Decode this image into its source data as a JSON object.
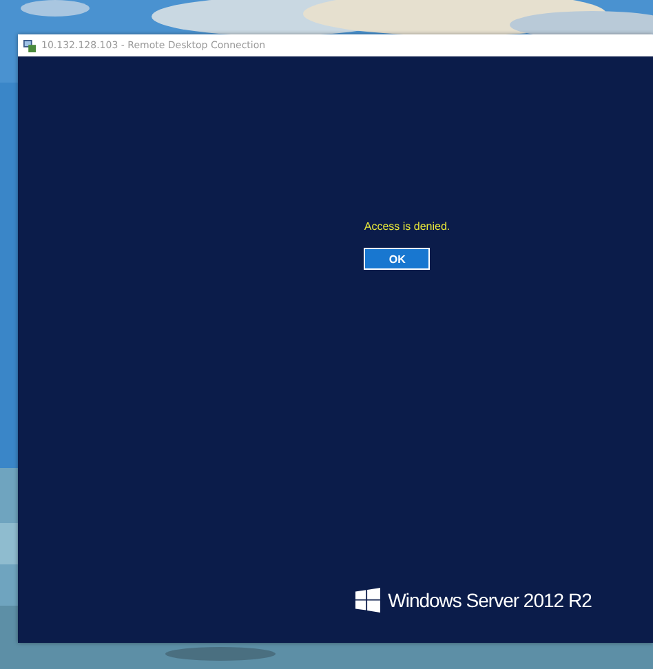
{
  "window": {
    "title": "10.132.128.103 - Remote Desktop Connection"
  },
  "dialog": {
    "message": "Access is denied.",
    "button": "OK"
  },
  "branding": {
    "text": "Windows Server 2012 R2"
  }
}
